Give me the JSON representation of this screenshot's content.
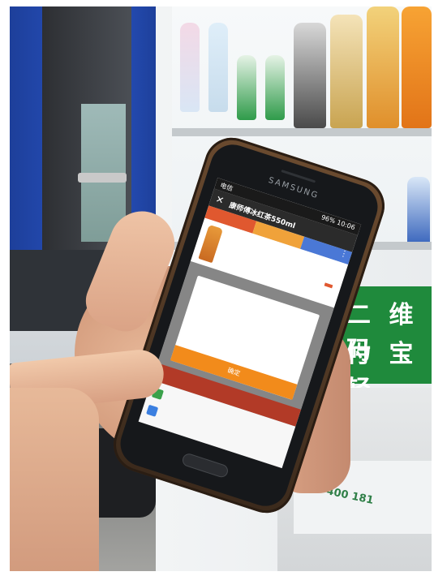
{
  "photo": {
    "vending_sign": {
      "line1": "二 维 码",
      "line2": "付 宝 轻"
    },
    "machine_strip": "400 181"
  },
  "phone": {
    "brand": "SAMSUNG",
    "status": {
      "left": "电信",
      "right": "96% 10:06"
    },
    "app": {
      "close_glyph": "✕",
      "title": "康师傅冰红茶550ml",
      "menu_glyph": "⋮",
      "tabs": [
        "",
        "",
        ""
      ],
      "product_name": "",
      "product_price": "",
      "buy_label": ""
    },
    "dialog": {
      "message": "",
      "confirm_label": "确定"
    },
    "payment": {
      "header": "",
      "items": [
        "",
        ""
      ]
    }
  }
}
